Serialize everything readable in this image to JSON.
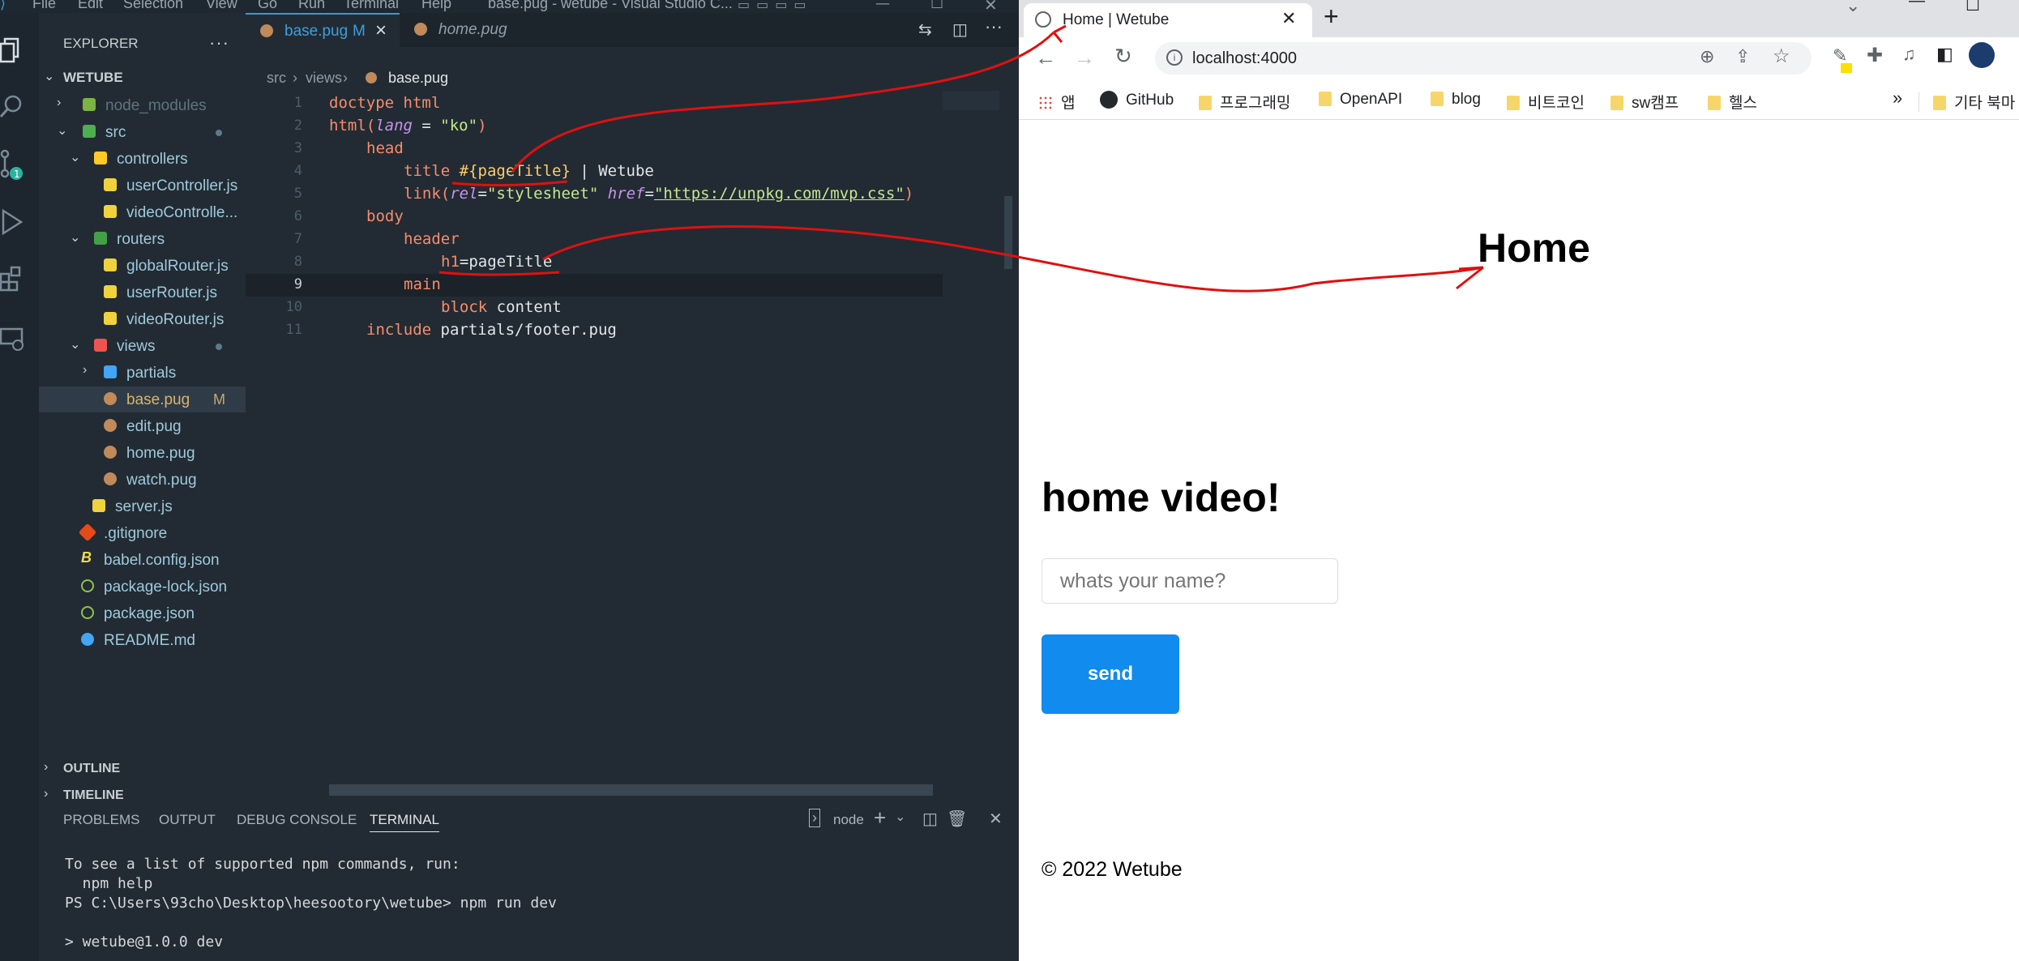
{
  "vscode": {
    "menu": [
      "File",
      "Edit",
      "Selection",
      "View",
      "Go",
      "Run",
      "Terminal",
      "Help"
    ],
    "window_title": "base.pug - wetube - Visual Studio C...",
    "explorer": {
      "title": "EXPLORER",
      "root": "WETUBE",
      "items": [
        {
          "label": "node_modules"
        },
        {
          "label": "src"
        },
        {
          "label": "controllers"
        },
        {
          "label": "userController.js"
        },
        {
          "label": "videoControlle..."
        },
        {
          "label": "routers"
        },
        {
          "label": "globalRouter.js"
        },
        {
          "label": "userRouter.js"
        },
        {
          "label": "videoRouter.js"
        },
        {
          "label": "views"
        },
        {
          "label": "partials"
        },
        {
          "label": "base.pug",
          "badge": "M"
        },
        {
          "label": "edit.pug"
        },
        {
          "label": "home.pug"
        },
        {
          "label": "watch.pug"
        },
        {
          "label": "server.js"
        },
        {
          "label": ".gitignore"
        },
        {
          "label": "babel.config.json"
        },
        {
          "label": "package-lock.json"
        },
        {
          "label": "package.json"
        },
        {
          "label": "README.md"
        }
      ],
      "outline": "OUTLINE",
      "timeline": "TIMELINE"
    },
    "tabs": [
      {
        "label": "base.pug",
        "badge": "M",
        "close": "×"
      },
      {
        "label": "home.pug"
      }
    ],
    "breadcrumb": {
      "a": "src",
      "b": "views",
      "c": "base.pug"
    },
    "code_lines": [
      {
        "n": "1"
      },
      {
        "n": "2"
      },
      {
        "n": "3"
      },
      {
        "n": "4"
      },
      {
        "n": "5"
      },
      {
        "n": "6"
      },
      {
        "n": "7"
      },
      {
        "n": "8"
      },
      {
        "n": "9"
      },
      {
        "n": "10"
      },
      {
        "n": "11"
      }
    ],
    "code": {
      "l1": "doctype html",
      "l2a": "html(",
      "l2b": "lang",
      "l2c": " = ",
      "l2d": "\"ko\"",
      "l2e": ")",
      "l3": "head",
      "l4a": "title ",
      "l4b": "#{pageTitle}",
      "l4c": " | Wetube",
      "l5a": "link(",
      "l5b": "rel",
      "l5c": "=",
      "l5d": "\"stylesheet\"",
      "l5e": " ",
      "l5f": "href",
      "l5g": "=",
      "l5h": "\"https://unpkg.com/mvp.css\"",
      "l5i": ")",
      "l6": "body",
      "l7": "header",
      "l8a": "h1",
      "l8b": "=pageTitle",
      "l9": "main",
      "l10a": "block",
      "l10b": " content",
      "l11a": "include",
      "l11b": " partials/footer.pug"
    },
    "panel": {
      "tabs": [
        "PROBLEMS",
        "OUTPUT",
        "DEBUG CONSOLE",
        "TERMINAL"
      ],
      "shell": "node",
      "terminal": "To see a list of supported npm commands, run:\n  npm help\nPS C:\\Users\\93cho\\Desktop\\heesootory\\wetube> npm run dev\n\n> wetube@1.0.0 dev"
    }
  },
  "browser": {
    "tab_title": "Home | Wetube",
    "new_tab": "+",
    "url": "localhost:4000",
    "bookmarks": [
      "앱",
      "GitHub",
      "프로그래밍",
      "OpenAPI",
      "blog",
      "비트코인",
      "sw캠프",
      "헬스"
    ],
    "more": "»",
    "other_bookmarks": "기타 북마",
    "page": {
      "h1": "Home",
      "h2": "home video!",
      "input_placeholder": "whats your name?",
      "button": "send",
      "footer": "© 2022 Wetube"
    },
    "accent": "#118bee"
  }
}
